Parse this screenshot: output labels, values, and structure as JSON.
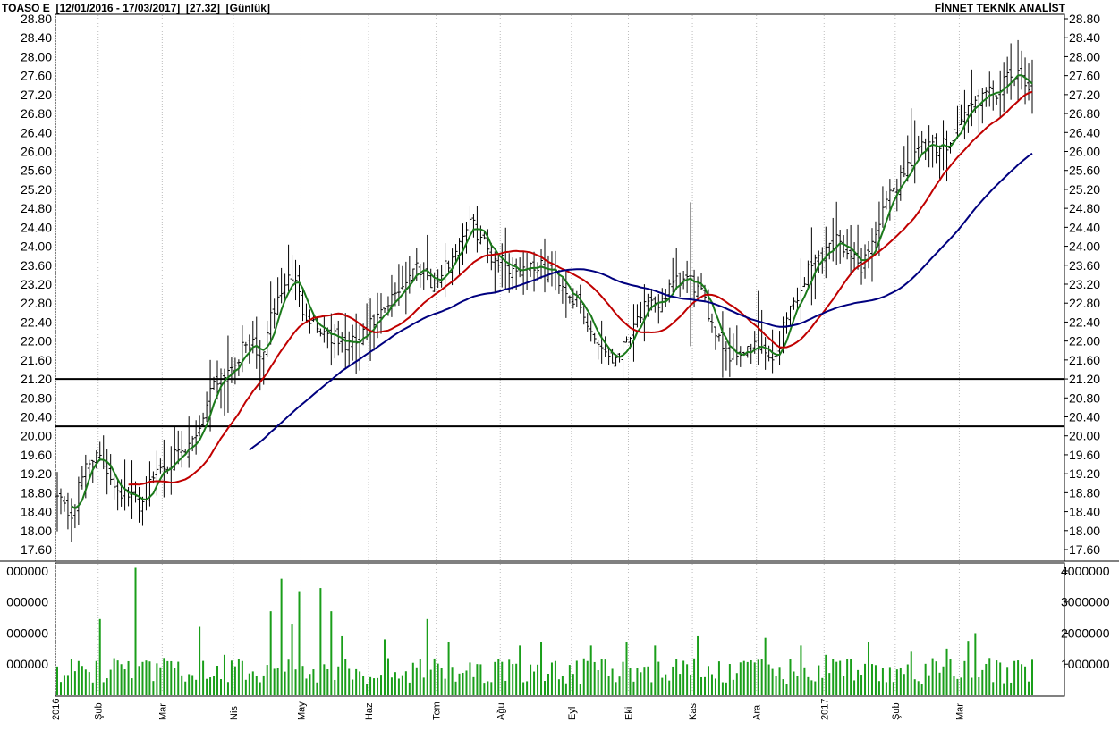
{
  "header": {
    "symbol": "TOASO E",
    "range": "[12/01/2016 - 17/03/2017]",
    "last": "[27.32]",
    "period": "[Günlük]",
    "source": "FİNNET TEKNİK ANALİST"
  },
  "chart_data": [
    {
      "type": "ohlc",
      "x_labels": [
        "2016",
        "Şub",
        "Mar",
        "Nis",
        "May",
        "Haz",
        "Tem",
        "Ağu",
        "Eyl",
        "Eki",
        "Kas",
        "Ara",
        "2017",
        "Şub",
        "Mar"
      ],
      "y_ticks": [
        "28.80",
        "28.40",
        "28.00",
        "27.60",
        "27.20",
        "26.80",
        "26.40",
        "26.00",
        "25.60",
        "25.20",
        "24.80",
        "24.40",
        "24.00",
        "23.60",
        "23.20",
        "22.80",
        "22.40",
        "22.00",
        "21.60",
        "21.20",
        "20.80",
        "20.40",
        "20.00",
        "19.60",
        "19.20",
        "18.80",
        "18.40",
        "18.00",
        "17.60"
      ],
      "ylim": [
        17.4,
        28.8
      ],
      "horizontal_lines": [
        21.2,
        20.2
      ],
      "price_path": [
        [
          0,
          18.9
        ],
        [
          2,
          18.5
        ],
        [
          4,
          18.3
        ],
        [
          8,
          19.4
        ],
        [
          10,
          19.6
        ],
        [
          14,
          19.3
        ],
        [
          17,
          18.9
        ],
        [
          20,
          18.7
        ],
        [
          24,
          18.6
        ],
        [
          28,
          19.3
        ],
        [
          32,
          19.5
        ],
        [
          36,
          19.6
        ],
        [
          40,
          20.2
        ],
        [
          44,
          21.2
        ],
        [
          48,
          21.4
        ],
        [
          51,
          21.7
        ],
        [
          54,
          22.0
        ],
        [
          57,
          21.6
        ],
        [
          61,
          22.7
        ],
        [
          64,
          23.2
        ],
        [
          66,
          23.4
        ],
        [
          69,
          22.7
        ],
        [
          73,
          22.3
        ],
        [
          77,
          22.1
        ],
        [
          81,
          21.9
        ],
        [
          85,
          22.0
        ],
        [
          89,
          22.4
        ],
        [
          92,
          22.6
        ],
        [
          95,
          23.0
        ],
        [
          98,
          23.3
        ],
        [
          101,
          23.6
        ],
        [
          103,
          23.5
        ],
        [
          106,
          23.2
        ],
        [
          108,
          23.4
        ],
        [
          111,
          23.8
        ],
        [
          114,
          24.3
        ],
        [
          116,
          24.5
        ],
        [
          119,
          24.2
        ],
        [
          122,
          23.8
        ],
        [
          125,
          23.7
        ],
        [
          128,
          23.5
        ],
        [
          131,
          23.6
        ],
        [
          134,
          23.6
        ],
        [
          137,
          23.5
        ],
        [
          140,
          23.4
        ],
        [
          143,
          23.1
        ],
        [
          146,
          22.8
        ],
        [
          149,
          22.3
        ],
        [
          152,
          22.0
        ],
        [
          154,
          21.8
        ],
        [
          156,
          21.6
        ],
        [
          159,
          21.9
        ],
        [
          162,
          22.4
        ],
        [
          165,
          22.7
        ],
        [
          168,
          22.7
        ],
        [
          171,
          23.0
        ],
        [
          174,
          23.2
        ],
        [
          177,
          23.3
        ],
        [
          180,
          23.1
        ],
        [
          183,
          22.6
        ],
        [
          186,
          22.1
        ],
        [
          189,
          21.7
        ],
        [
          192,
          21.8
        ],
        [
          195,
          21.8
        ],
        [
          198,
          21.9
        ],
        [
          200,
          21.5
        ],
        [
          202,
          21.7
        ],
        [
          205,
          22.6
        ],
        [
          208,
          22.9
        ],
        [
          211,
          23.5
        ],
        [
          214,
          23.8
        ],
        [
          217,
          24.0
        ],
        [
          220,
          24.2
        ],
        [
          223,
          23.7
        ],
        [
          226,
          23.6
        ],
        [
          229,
          24.1
        ],
        [
          232,
          24.7
        ],
        [
          235,
          25.2
        ],
        [
          238,
          25.6
        ],
        [
          241,
          26.0
        ],
        [
          244,
          26.1
        ],
        [
          247,
          26.0
        ],
        [
          250,
          26.2
        ],
        [
          253,
          26.6
        ],
        [
          256,
          26.9
        ],
        [
          259,
          27.1
        ],
        [
          262,
          27.2
        ],
        [
          265,
          27.3
        ],
        [
          268,
          27.6
        ],
        [
          271,
          27.5
        ],
        [
          274,
          27.3
        ]
      ],
      "bars": 275,
      "series": [
        {
          "color": "#1b7a1b",
          "period": 5
        },
        {
          "color": "#c00000",
          "period": 21
        },
        {
          "color": "#00007f",
          "period": 55
        }
      ]
    },
    {
      "type": "bar",
      "y_ticks": [
        "4000000",
        "3000000",
        "2000000",
        "1000000"
      ],
      "ylim": [
        0,
        4200000
      ],
      "color": "#1a9e1a",
      "baseline_volume": 600000,
      "spikes": [
        [
          6,
          1100000
        ],
        [
          12,
          2450000
        ],
        [
          18,
          1000000
        ],
        [
          22,
          4100000
        ],
        [
          30,
          1200000
        ],
        [
          40,
          2200000
        ],
        [
          47,
          1300000
        ],
        [
          52,
          1100000
        ],
        [
          60,
          2700000
        ],
        [
          63,
          3750000
        ],
        [
          66,
          2300000
        ],
        [
          68,
          3350000
        ],
        [
          74,
          3450000
        ],
        [
          77,
          2700000
        ],
        [
          80,
          1900000
        ],
        [
          92,
          1800000
        ],
        [
          104,
          2450000
        ],
        [
          110,
          1700000
        ],
        [
          130,
          1600000
        ],
        [
          136,
          1700000
        ],
        [
          150,
          1600000
        ],
        [
          160,
          1700000
        ],
        [
          168,
          1600000
        ],
        [
          180,
          1900000
        ],
        [
          199,
          1850000
        ],
        [
          209,
          1600000
        ],
        [
          216,
          1300000
        ],
        [
          228,
          1700000
        ],
        [
          240,
          1400000
        ],
        [
          250,
          1500000
        ],
        [
          256,
          1750000
        ],
        [
          258,
          2000000
        ],
        [
          262,
          1200000
        ],
        [
          271,
          1000000
        ]
      ]
    }
  ]
}
